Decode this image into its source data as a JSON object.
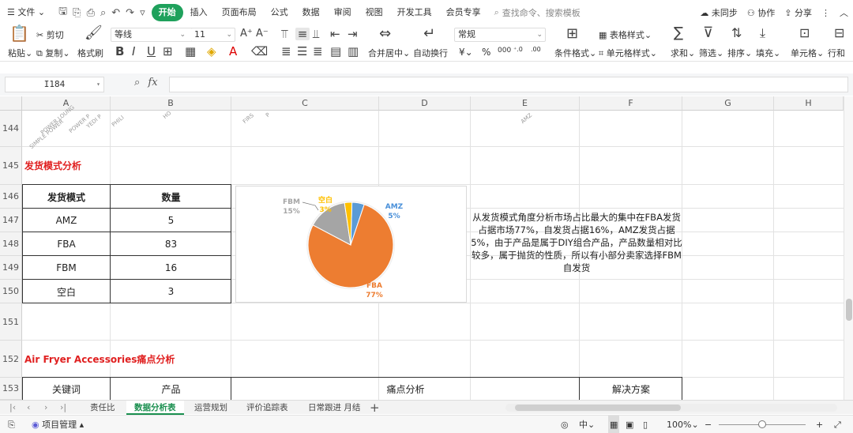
{
  "menubar": {
    "file": "文件",
    "tabs": [
      "开始",
      "插入",
      "页面布局",
      "公式",
      "数据",
      "审阅",
      "视图",
      "开发工具",
      "会员专享"
    ],
    "active_tab": "开始",
    "search_placeholder": "查找命令、搜索模板",
    "sync": "未同步",
    "collab": "协作",
    "share": "分享"
  },
  "ribbon": {
    "paste": "粘贴",
    "cut": "剪切",
    "copy": "复制",
    "format_painter": "格式刷",
    "font_name": "等线",
    "font_size": "11",
    "merge": "合并居中",
    "wrap": "自动换行",
    "number_format": "常规",
    "cond_format": "条件格式",
    "table_style": "表格样式",
    "cell_style": "单元格样式",
    "sum": "求和",
    "filter": "筛选",
    "sort": "排序",
    "fill": "填充",
    "cell": "单元格",
    "row_col": "行和"
  },
  "formula_bar": {
    "name_box": "I184",
    "formula": ""
  },
  "columns": [
    "A",
    "B",
    "C",
    "D",
    "E",
    "F",
    "G",
    "H"
  ],
  "rows": [
    "144",
    "145",
    "146",
    "147",
    "148",
    "149",
    "150",
    "151",
    "152",
    "153"
  ],
  "row144_partial": {
    "a1": "POWER LOUNG",
    "a2": "SIMPLE POWER",
    "a3": "POWER P",
    "a4": "YEDI P",
    "b1": "PHILI",
    "b2": "HO",
    "c1": "FIRS",
    "c2": "P",
    "e1": "AMZ"
  },
  "section1_title": "发货模式分析",
  "ship_table": {
    "headers": [
      "发货模式",
      "数量"
    ],
    "rows": [
      [
        "AMZ",
        "5"
      ],
      [
        "FBA",
        "83"
      ],
      [
        "FBM",
        "16"
      ],
      [
        "空白",
        "3"
      ]
    ]
  },
  "analysis_text": "从发货模式角度分析市场占比最大的集中在FBA发货占据市场77%，自发货占据16%，AMZ发货占据5%，由于产品是属于DIY组合产品，产品数量相对比较多，属于抛货的性质，所以有小部分卖家选择FBM自发货",
  "section2_title": "Air Fryer Accessories痛点分析",
  "pain_table": {
    "headers": [
      "关键词",
      "产品",
      "痛点分析",
      "解决方案"
    ]
  },
  "chart_data": {
    "type": "pie",
    "title": "",
    "categories": [
      "AMZ",
      "FBA",
      "FBM",
      "空白"
    ],
    "values": [
      5,
      83,
      16,
      3
    ],
    "labels": [
      {
        "name": "AMZ",
        "pct": "5%",
        "color": "#4a90d9"
      },
      {
        "name": "FBA",
        "pct": "77%",
        "color": "#ed7d31"
      },
      {
        "name": "FBM",
        "pct": "15%",
        "color": "#a5a5a5"
      },
      {
        "name": "空白",
        "pct": "3%",
        "color": "#ffc000"
      }
    ],
    "colors": [
      "#5b9bd5",
      "#ed7d31",
      "#a5a5a5",
      "#ffc000"
    ]
  },
  "sheet_tabs": [
    "责任比",
    "数据分析表",
    "运营规划",
    "评价追踪表",
    "日常跟进 月结"
  ],
  "active_sheet": "数据分析表",
  "status": {
    "project": "项目管理",
    "ime": "中",
    "zoom": "100%"
  }
}
